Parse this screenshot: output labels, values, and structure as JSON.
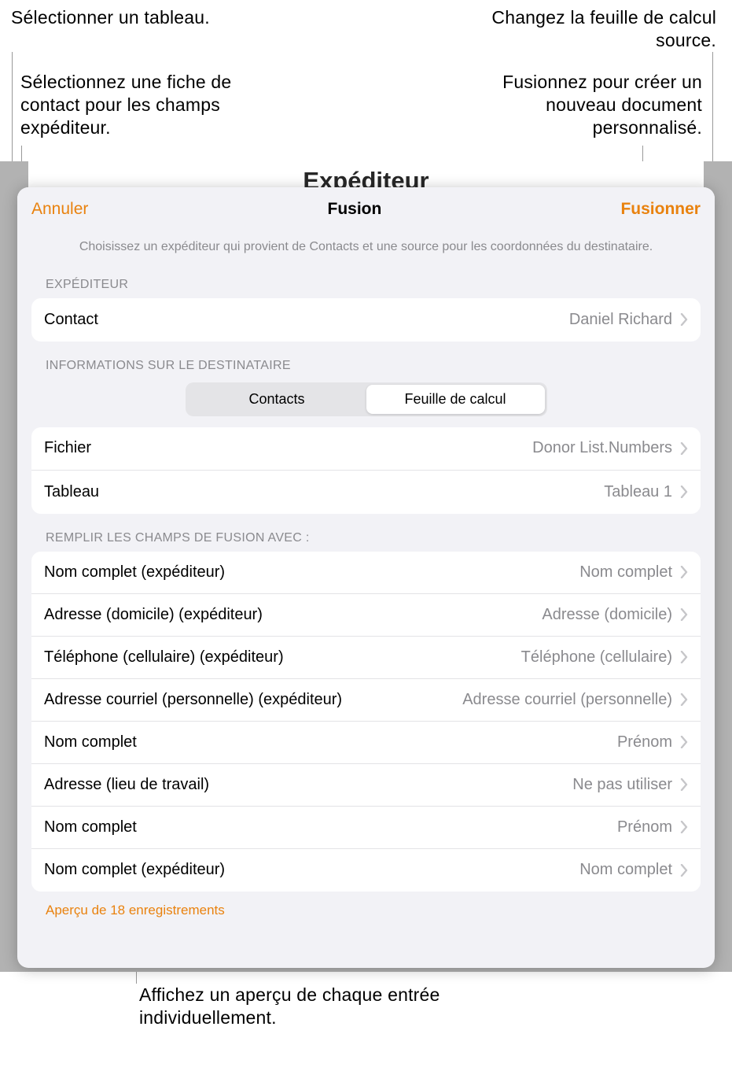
{
  "callouts": {
    "top_left_1": "Sélectionner un tableau.",
    "top_left_2": "Sélectionnez une fiche de contact pour les champs expéditeur.",
    "top_right_1": "Changez la feuille de calcul source.",
    "top_right_2": "Fusionnez pour créer un nouveau document personnalisé.",
    "bottom": "Affichez un aperçu de chaque entrée individuellement."
  },
  "doc_title_peek": "Expéditeur",
  "header": {
    "cancel": "Annuler",
    "title": "Fusion",
    "merge": "Fusionner"
  },
  "subheader": "Choisissez un expéditeur qui provient de Contacts et une source pour les coordonnées du destinataire.",
  "sections": {
    "sender_label": "EXPÉDITEUR",
    "recipient_label": "INFORMATIONS SUR LE DESTINATAIRE",
    "fill_label": "REMPLIR LES CHAMPS DE FUSION AVEC :"
  },
  "sender": {
    "contact_label": "Contact",
    "contact_value": "Daniel Richard"
  },
  "segments": {
    "contacts": "Contacts",
    "spreadsheet": "Feuille de calcul"
  },
  "source": {
    "file_label": "Fichier",
    "file_value": "Donor List.Numbers",
    "table_label": "Tableau",
    "table_value": "Tableau 1"
  },
  "merge_fields": [
    {
      "label": "Nom complet (expéditeur)",
      "value": "Nom complet"
    },
    {
      "label": "Adresse (domicile) (expéditeur)",
      "value": "Adresse (domicile)"
    },
    {
      "label": "Téléphone (cellulaire) (expéditeur)",
      "value": "Téléphone (cellulaire)"
    },
    {
      "label": "Adresse courriel (personnelle) (expéditeur)",
      "value": "Adresse courriel (personnelle)"
    },
    {
      "label": "Nom complet",
      "value": "Prénom"
    },
    {
      "label": "Adresse (lieu de travail)",
      "value": "Ne pas utiliser"
    },
    {
      "label": "Nom complet",
      "value": "Prénom"
    },
    {
      "label": "Nom complet (expéditeur)",
      "value": "Nom complet"
    }
  ],
  "preview_link": "Aperçu de 18 enregistrements"
}
